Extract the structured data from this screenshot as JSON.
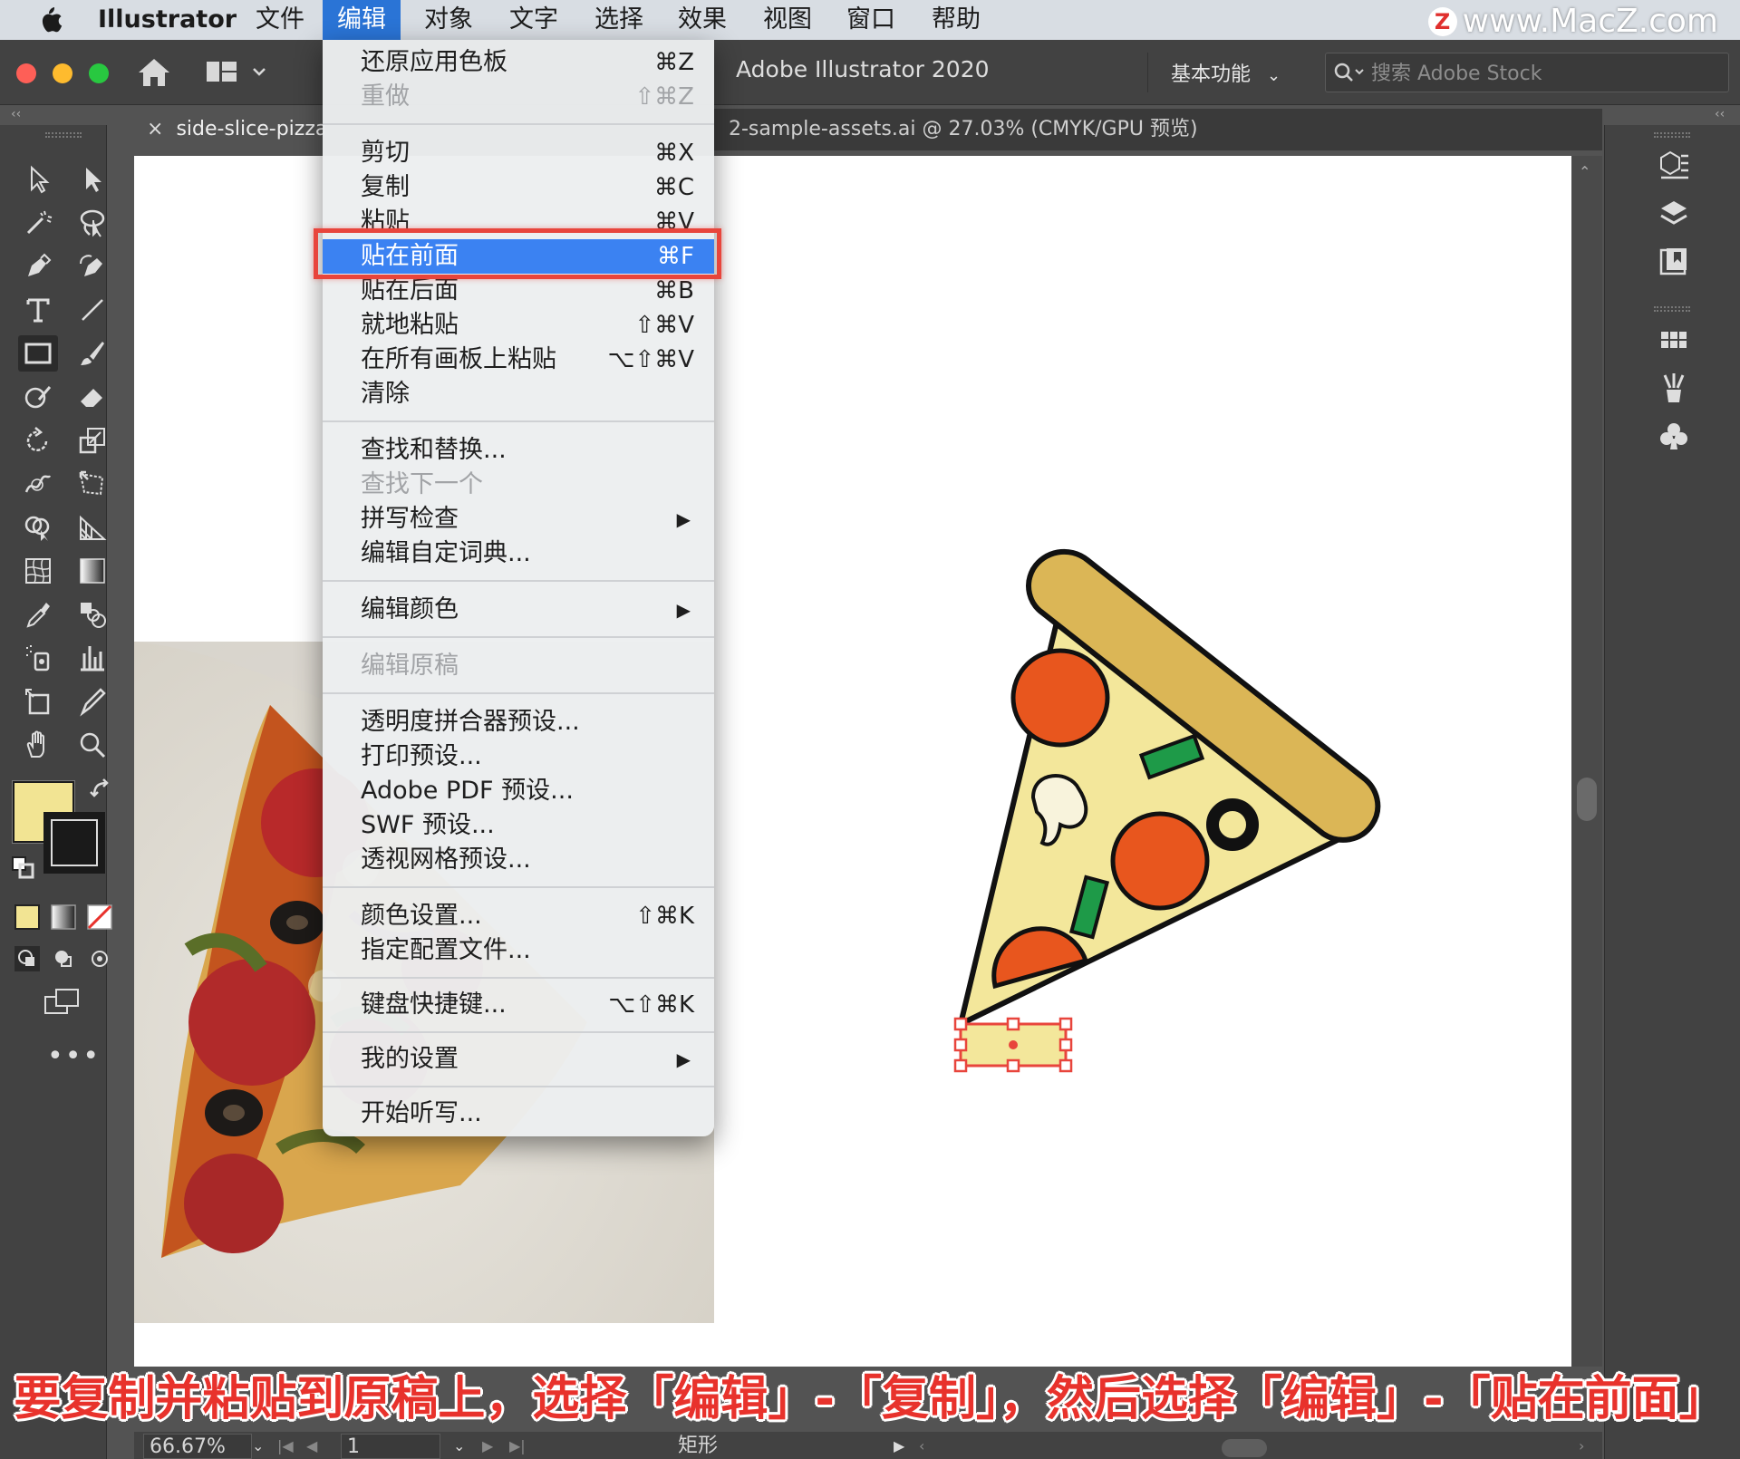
{
  "menubar": {
    "app": "Illustrator",
    "items": [
      "文件",
      "编辑",
      "对象",
      "文字",
      "选择",
      "效果",
      "视图",
      "窗口",
      "帮助"
    ],
    "active": "编辑",
    "watermark_badge": "Z",
    "watermark": "www.MacZ.com"
  },
  "appbar": {
    "title": "Adobe Illustrator 2020",
    "workspace": "基本功能",
    "search_placeholder": "搜索 Adobe Stock",
    "colors": {
      "close": "#fe5f57",
      "minimize": "#febb2e",
      "zoom": "#28c840"
    }
  },
  "tabs": [
    {
      "label": "side-slice-pizza-",
      "close": "×",
      "active": true
    },
    {
      "label": "2-sample-assets.ai @ 27.03% (CMYK/GPU 预览)",
      "active": false
    }
  ],
  "edit_menu": {
    "groups": [
      [
        {
          "label": "还原应用色板",
          "shortcut": "⌘Z"
        },
        {
          "label": "重做",
          "shortcut": "⇧⌘Z",
          "disabled": true
        }
      ],
      [
        {
          "label": "剪切",
          "shortcut": "⌘X"
        },
        {
          "label": "复制",
          "shortcut": "⌘C"
        },
        {
          "label": "粘贴",
          "shortcut": "⌘V"
        },
        {
          "label": "贴在前面",
          "shortcut": "⌘F",
          "highlighted": true
        },
        {
          "label": "贴在后面",
          "shortcut": "⌘B"
        },
        {
          "label": "就地粘贴",
          "shortcut": "⇧⌘V"
        },
        {
          "label": "在所有画板上粘贴",
          "shortcut": "⌥⇧⌘V"
        },
        {
          "label": "清除",
          "shortcut": ""
        }
      ],
      [
        {
          "label": "查找和替换...",
          "shortcut": ""
        },
        {
          "label": "查找下一个",
          "shortcut": "",
          "disabled": true
        },
        {
          "label": "拼写检查",
          "submenu": true
        },
        {
          "label": "编辑自定词典...",
          "shortcut": ""
        }
      ],
      [
        {
          "label": "编辑颜色",
          "submenu": true
        }
      ],
      [
        {
          "label": "编辑原稿",
          "shortcut": "",
          "disabled": true
        }
      ],
      [
        {
          "label": "透明度拼合器预设...",
          "shortcut": ""
        },
        {
          "label": "打印预设...",
          "shortcut": ""
        },
        {
          "label": "Adobe PDF 预设...",
          "shortcut": ""
        },
        {
          "label": "SWF 预设...",
          "shortcut": ""
        },
        {
          "label": "透视网格预设...",
          "shortcut": ""
        }
      ],
      [
        {
          "label": "颜色设置...",
          "shortcut": "⇧⌘K"
        },
        {
          "label": "指定配置文件...",
          "shortcut": ""
        }
      ],
      [
        {
          "label": "键盘快捷键...",
          "shortcut": "⌥⇧⌘K"
        }
      ],
      [
        {
          "label": "我的设置",
          "submenu": true
        }
      ],
      [
        {
          "label": "开始听写...",
          "shortcut": ""
        }
      ]
    ],
    "highlight_color": "#3b82f2",
    "annotation_color": "#e8453c"
  },
  "toolbar": {
    "fill_color": "#f2e493",
    "stroke_color": "#1a1a1a",
    "more_label": "•••"
  },
  "caption": "要复制并粘贴到原稿上，选择「编辑」-「复制」，然后选择「编辑」-「贴在前面」",
  "statusbar": {
    "zoom": "66.67%",
    "page": "1",
    "current_tool": "矩形"
  },
  "artwork": {
    "crust_color": "#dbb656",
    "cheese_color": "#f3e79b",
    "pepperoni_color": "#e8561e",
    "pepper_color": "#1e9a48",
    "mushroom_color": "#f8f3dc",
    "selection_color": "#e8453c"
  }
}
